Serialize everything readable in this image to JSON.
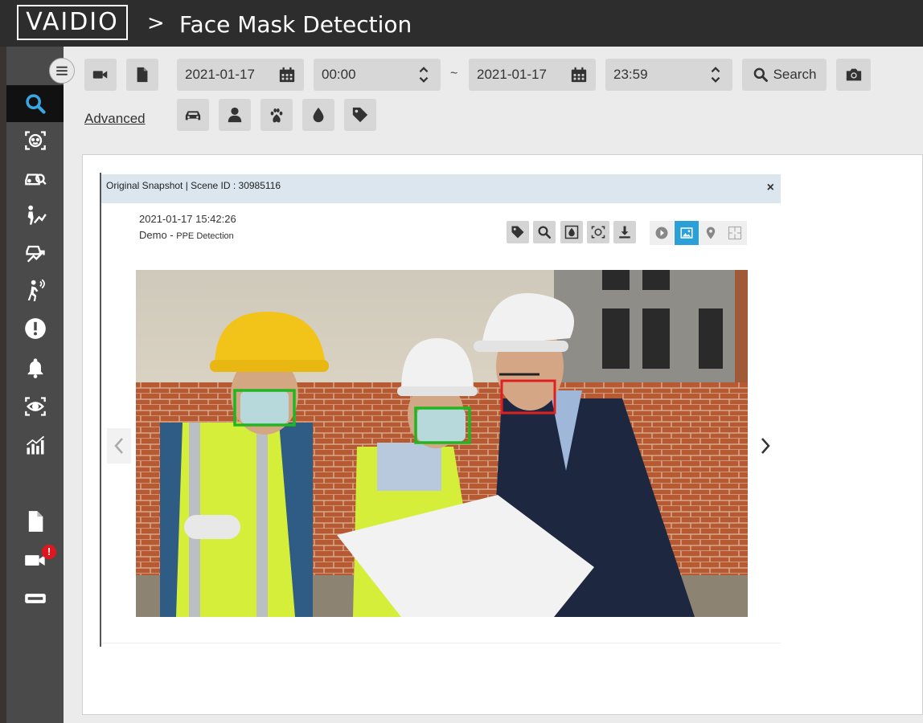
{
  "header": {
    "logo_text": "VAIDIO",
    "breadcrumb_separator": ">",
    "title": "Face Mask Detection"
  },
  "sidebar": {
    "items": [
      {
        "name": "search",
        "icon": "search-icon",
        "active": true
      },
      {
        "name": "face",
        "icon": "face-icon"
      },
      {
        "name": "vehicle",
        "icon": "vehicle-search-icon"
      },
      {
        "name": "person-trend",
        "icon": "person-trend-icon"
      },
      {
        "name": "vehicle-trend",
        "icon": "vehicle-trend-icon"
      },
      {
        "name": "intrusion",
        "icon": "running-person-icon"
      },
      {
        "name": "alerts",
        "icon": "exclamation-icon"
      },
      {
        "name": "notifications",
        "icon": "bell-icon"
      },
      {
        "name": "watch",
        "icon": "eye-scan-icon"
      },
      {
        "name": "reports",
        "icon": "bar-chart-icon"
      },
      {
        "name": "documents",
        "icon": "document-icon"
      },
      {
        "name": "cameras",
        "icon": "camera-icon",
        "badge": "!"
      },
      {
        "name": "devices",
        "icon": "device-icon"
      }
    ]
  },
  "toolbar": {
    "start_date": "2021-01-17",
    "start_time": "00:00",
    "range_separator": "~",
    "end_date": "2021-01-17",
    "end_time": "23:59",
    "search_label": "Search",
    "advanced_label": "Advanced",
    "filter_icons": [
      "car-icon",
      "person-icon",
      "paw-icon",
      "drop-icon",
      "tag-icon"
    ]
  },
  "snapshot": {
    "header_title": "Original Snapshot | Scene ID : 30985116",
    "close_label": "×",
    "timestamp": "2021-01-17 15:42:26",
    "camera": "Demo -",
    "analytic": "PPE Detection",
    "action_icons": [
      "tag-icon",
      "search-icon",
      "drop-icon",
      "face-scan-icon",
      "download-icon"
    ],
    "view_icons": [
      "play-icon",
      "image-icon",
      "map-pin-icon",
      "floorplan-icon"
    ],
    "active_view": "image-icon",
    "detection_colors": {
      "mask": "#22b522",
      "no_mask": "#e02020"
    }
  },
  "colors": {
    "topbar": "#2d2d2d",
    "sidebar": "#4a4a4a",
    "accent": "#2a9fd8",
    "badge": "#e0161e"
  }
}
